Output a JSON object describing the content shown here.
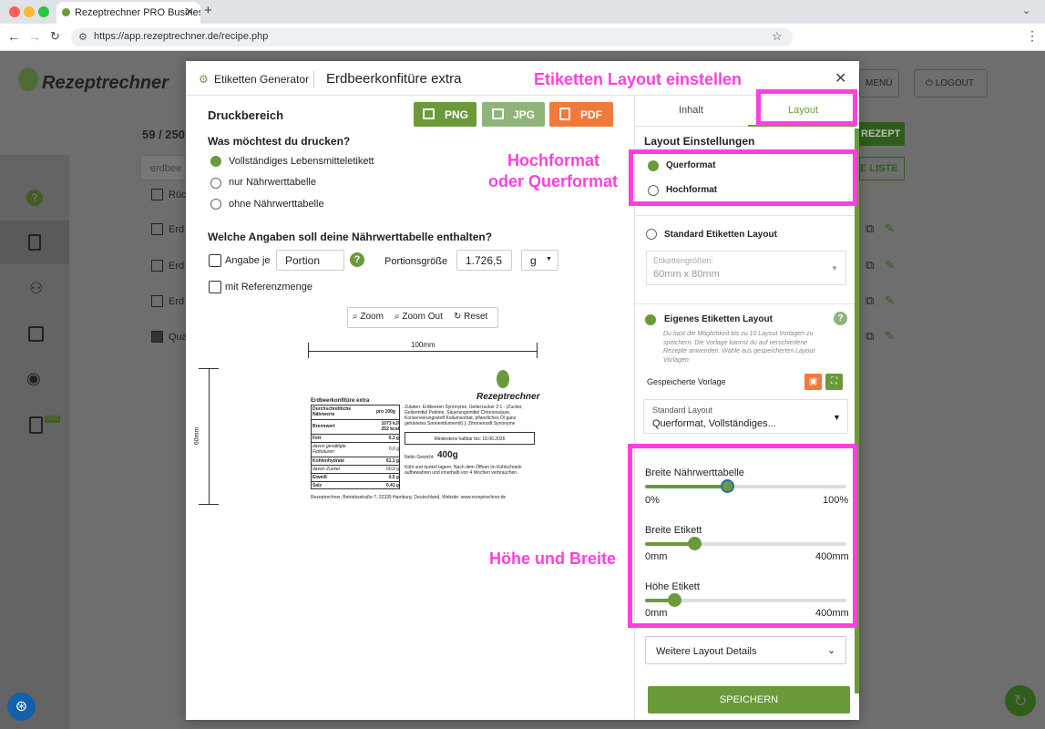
{
  "browser": {
    "tab_title": "Rezeptrechner PRO Business",
    "url": "https://app.rezeptrechner.de/recipe.php"
  },
  "app": {
    "logo": "Rezeptrechner",
    "menu_label": "MENÜ",
    "logout_label": "LOGOUT",
    "count": "59 / 250",
    "search_placeholder": "erdbee",
    "new_recipe": "REZEPT",
    "list_btn": "E LISTE",
    "rows": [
      "Rüc",
      "Erd",
      "Erd",
      "Erd",
      "Qua"
    ],
    "badge": "NEU"
  },
  "modal": {
    "generator_label": "Etiketten Generator",
    "title": "Erdbeerkonfitüre extra",
    "print_area": "Druckbereich",
    "export": {
      "png": "PNG",
      "jpg": "JPG",
      "pdf": "PDF"
    },
    "question_print": "Was möchtest du drucken?",
    "print_options": [
      "Vollständiges Lebensmitteletikett",
      "nur Nährwerttabelle",
      "ohne Nährwerttabelle"
    ],
    "question_nutrition": "Welche Angaben soll deine Nährwerttabelle enthalten?",
    "per_label": "Angabe je",
    "per_value": "Portion",
    "portion_size_label": "Portionsgröße",
    "portion_size_value": "1.726,5",
    "unit": "g",
    "reference_label": "mit Referenzmenge",
    "zoom": {
      "zoom_in": "Zoom",
      "zoom_out": "Zoom Out",
      "reset": "Reset"
    },
    "preview": {
      "width_dim": "100mm",
      "height_dim": "60mm",
      "logo": "Rezeptrechner",
      "product": "Erdbeerkonfitüre extra",
      "table_head": [
        "Durchschnittliche Nährwerte",
        "pro 100g"
      ],
      "table_rows": [
        [
          "Brennwert",
          "1073 kJ/ 252 kcal"
        ],
        [
          "Fett",
          "0,3 g"
        ],
        [
          "davon gesättigte Fettsäuren",
          "0,0 g"
        ],
        [
          "Kohlenhydrate",
          "61,1 g"
        ],
        [
          "davon Zucker",
          "60,9 g"
        ],
        [
          "Eiweiß",
          "0,5 g"
        ],
        [
          "Salz",
          "0,41 g"
        ]
      ],
      "ingredients": "Zutaten: Erdbeeren Synonyme, Gelierzucker 2:1 - (Zucker, Geliermittel Pektine, Säuerungsmittel Citronensäure, Konservierungsstoff Kaliumsorbat, pflanzliches Öl ganz gehärtetes Sonnenblumenöl).), Zitronensaft Synonyme",
      "best_before": "Mindestens haltbar bis: 18.06.2026",
      "net_weight_label": "Netto Gewicht:",
      "net_weight": "400g",
      "storage": "Kühl und dunkel lagern. Nach dem Öffnen im Kühlschrank aufbewahren und innerhalb von 4 Wochen verbrauchen.",
      "address": "Rezeptrechner, Betriebsstraße 7, 22335 Hamburg, Deutschland, Website: www.rezeptrechner.de"
    },
    "tabs": [
      "Inhalt",
      "Layout"
    ],
    "layout_settings": "Layout Einstellungen",
    "orientation": [
      "Querformat",
      "Hochformat"
    ],
    "standard_layout": "Standard Etiketten Layout",
    "label_sizes_label": "Etikettengrößen:",
    "label_sizes_value": "60mm x 80mm",
    "own_layout": "Eigenes Etiketten Layout",
    "own_layout_hint": "Du hast die Möglichkeit bis zu 10 Layout Vorlagen zu speichern. Die Vorlage kannst du auf verschiedene Rezepte anwenden. Wähle aus gespeicherten Layout Vorlagen:",
    "saved_template": "Gespeicherte Vorlage",
    "template_label": "Standard Layout",
    "template_value": "Querformat, Vollständiges...",
    "sliders": [
      {
        "label": "Breite Nährwerttabelle",
        "min": "0%",
        "max": "100%",
        "value": 0.41
      },
      {
        "label": "Breite Etikett",
        "min": "0mm",
        "max": "400mm",
        "value": 0.25
      },
      {
        "label": "Höhe Etikett",
        "min": "0mm",
        "max": "400mm",
        "value": 0.15
      }
    ],
    "more_details": "Weitere Layout Details",
    "save": "SPEICHERN"
  },
  "annotations": {
    "layout": "Etiketten Layout einstellen",
    "orientation_1": "Hochformat",
    "orientation_2": "oder Querformat",
    "size": "Höhe und Breite"
  },
  "colors": {
    "green": "#6a9a3a",
    "orange": "#f07a3a",
    "light_green": "#8fb47a",
    "magenta": "#ff3fe0"
  }
}
